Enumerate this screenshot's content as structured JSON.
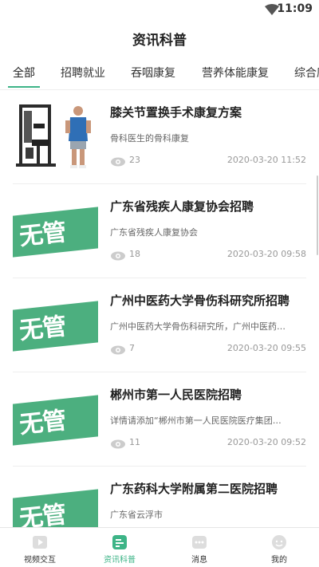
{
  "status_bar": {
    "time": "11:09"
  },
  "page_title": "资讯科普",
  "tabs": [
    {
      "label": "全部",
      "active": true
    },
    {
      "label": "招聘就业"
    },
    {
      "label": "吞咽康复"
    },
    {
      "label": "营养体能康复"
    },
    {
      "label": "综合康"
    }
  ],
  "articles": [
    {
      "title": "膝关节置换手术康复方案",
      "desc": "骨科医生的骨科康复",
      "views": "23",
      "date": "2020-03-20 11:52",
      "thumb": "gym-photo"
    },
    {
      "title": "广东省残疾人康复协会招聘",
      "desc": "广东省残疾人康复协会",
      "views": "18",
      "date": "2020-03-20 09:58",
      "thumb": "wuguan-logo",
      "thumb_text": "无管"
    },
    {
      "title": "广州中医药大学骨伤科研究所招聘",
      "desc": "广州中医药大学骨伤科研究所，广州中医药…",
      "views": "7",
      "date": "2020-03-20 09:55",
      "thumb": "wuguan-logo",
      "thumb_text": "无管"
    },
    {
      "title": "郴州市第一人民医院招聘",
      "desc": "详情请添加“郴州市第一人民医院医疗集团…",
      "views": "11",
      "date": "2020-03-20 09:52",
      "thumb": "wuguan-logo",
      "thumb_text": "无管"
    },
    {
      "title": "广东药科大学附属第二医院招聘",
      "desc": "广东省云浮市",
      "views": "",
      "date": "",
      "thumb": "wuguan-logo",
      "thumb_text": "无管"
    }
  ],
  "bottom_nav": [
    {
      "label": "视频交互",
      "icon": "video-play-icon"
    },
    {
      "label": "资讯科普",
      "icon": "news-icon",
      "active": true
    },
    {
      "label": "消息",
      "icon": "message-icon"
    },
    {
      "label": "我的",
      "icon": "profile-icon"
    }
  ],
  "colors": {
    "accent": "#3db487",
    "logo_green": "#4caf7f"
  }
}
